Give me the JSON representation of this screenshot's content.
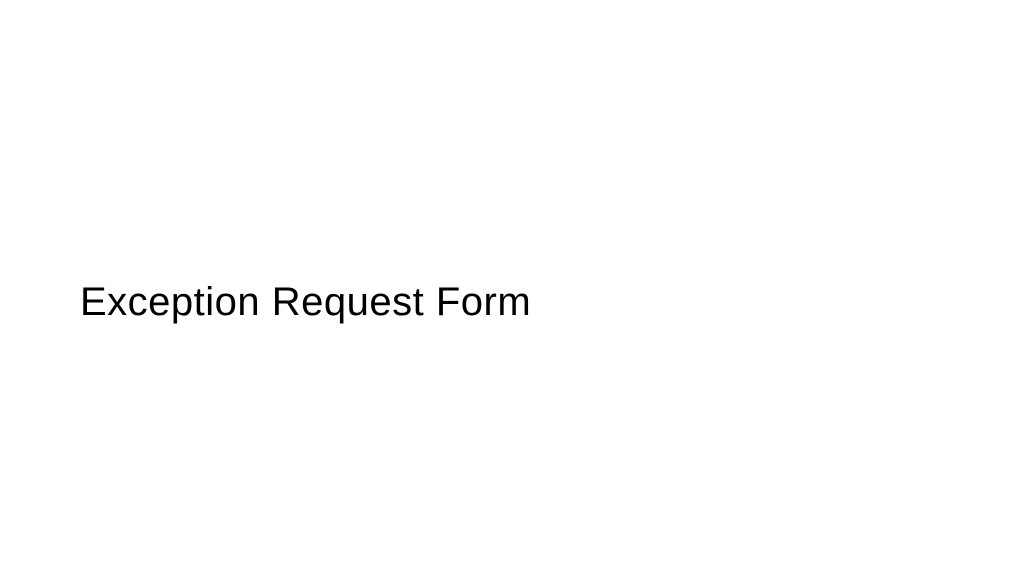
{
  "slide": {
    "title": "Exception Request Form"
  }
}
